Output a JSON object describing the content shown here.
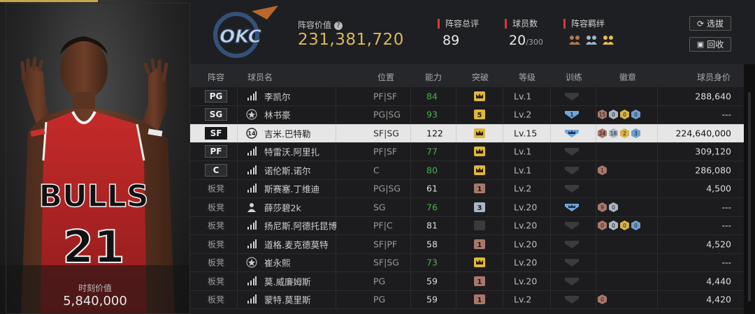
{
  "player_card": {
    "value_label": "时刻价值",
    "value": "5,840,000",
    "jersey_team": "BULLS",
    "jersey_number": "21"
  },
  "header": {
    "team_logo": "OKC",
    "lineup_value_label": "阵容价值",
    "lineup_value": "231,381,720",
    "rating_label": "阵容总评",
    "rating_value": "89",
    "count_label": "球员数",
    "count_value": "20",
    "count_max": "/300",
    "bond_label": "阵容羁绊",
    "select_button": "选拔",
    "recycle_button": "回收"
  },
  "table": {
    "headers": {
      "lineup": "阵容",
      "name": "球员名",
      "position": "位置",
      "ability": "能力",
      "breakthrough": "突破",
      "level": "等级",
      "training": "训练",
      "badges": "徽章",
      "price": "球员身价"
    },
    "rows": [
      {
        "slot": "PG",
        "bench": false,
        "role": "chart",
        "name": "李凯尔",
        "pos": "PF|SF",
        "ability": "84",
        "ability_color": "#4caf50",
        "break": "crown",
        "break_tier": "gold",
        "level": "Lv.1",
        "train": "none",
        "badges": [],
        "price": "288,640"
      },
      {
        "slot": "SG",
        "bench": false,
        "role": "star",
        "name": "林书豪",
        "pos": "PG|SG",
        "ability": "93",
        "ability_color": "#4caf50",
        "break": "5",
        "break_tier": "gold",
        "level": "Lv.2",
        "train": "1",
        "badges": [
          "15",
          "0",
          "0",
          "0"
        ],
        "price": "---"
      },
      {
        "slot": "SF",
        "bench": false,
        "role": "jersey-14",
        "name": "吉米.巴特勒",
        "pos": "SF|SG",
        "ability": "122",
        "ability_color": "#111111",
        "break": "crown",
        "break_tier": "gold",
        "level": "Lv.15",
        "train": "crown",
        "badges": [
          "24",
          "18",
          "2",
          "3"
        ],
        "price": "224,640,000",
        "selected": true
      },
      {
        "slot": "PF",
        "bench": false,
        "role": "chart",
        "name": "特雷沃.阿里扎",
        "pos": "PF|SF",
        "ability": "77",
        "ability_color": "#4caf50",
        "break": "crown",
        "break_tier": "gold",
        "level": "Lv.1",
        "train": "none",
        "badges": [],
        "price": "309,120"
      },
      {
        "slot": "C",
        "bench": false,
        "role": "chart",
        "name": "诺伦斯.诺尔",
        "pos": "C",
        "ability": "80",
        "ability_color": "#4caf50",
        "break": "crown",
        "break_tier": "gold",
        "level": "Lv.1",
        "train": "none",
        "badges": [
          "1"
        ],
        "price": "286,080"
      },
      {
        "slot": "板凳",
        "bench": true,
        "role": "chart",
        "name": "斯赛塞.丁维迪",
        "pos": "PG|SG",
        "ability": "61",
        "ability_color": "#dddddd",
        "break": "1",
        "break_tier": "bronze",
        "level": "Lv.2",
        "train": "none",
        "badges": [],
        "price": "4,500"
      },
      {
        "slot": "板凳",
        "bench": true,
        "role": "person",
        "name": "薛莎碧2k",
        "pos": "SG",
        "ability": "76",
        "ability_color": "#4caf50",
        "break": "3",
        "break_tier": "silver",
        "level": "Lv.20",
        "train": "crown",
        "badges": [
          "9",
          "0"
        ],
        "price": "---"
      },
      {
        "slot": "板凳",
        "bench": true,
        "role": "chart",
        "name": "扬尼斯.阿德托昆博",
        "pos": "PF|C",
        "ability": "81",
        "ability_color": "#dddddd",
        "break": "",
        "break_tier": "none",
        "level": "Lv.20",
        "train": "none",
        "badges": [
          "0",
          "0",
          "0",
          "0"
        ],
        "price": "---"
      },
      {
        "slot": "板凳",
        "bench": true,
        "role": "chart",
        "name": "道格.麦克德莫特",
        "pos": "SF|PF",
        "ability": "58",
        "ability_color": "#dddddd",
        "break": "1",
        "break_tier": "bronze",
        "level": "Lv.20",
        "train": "none",
        "badges": [],
        "price": "4,520"
      },
      {
        "slot": "板凳",
        "bench": true,
        "role": "star",
        "name": "崔永熙",
        "pos": "SF|SG",
        "ability": "73",
        "ability_color": "#4caf50",
        "break": "crown",
        "break_tier": "gold",
        "level": "Lv.20",
        "train": "none",
        "badges": [],
        "price": "---"
      },
      {
        "slot": "板凳",
        "bench": true,
        "role": "chart",
        "name": "莫.威廉姆斯",
        "pos": "PG",
        "ability": "59",
        "ability_color": "#dddddd",
        "break": "1",
        "break_tier": "bronze",
        "level": "Lv.20",
        "train": "none",
        "badges": [],
        "price": "4,440"
      },
      {
        "slot": "板凳",
        "bench": true,
        "role": "chart",
        "name": "蒙特.莫里斯",
        "pos": "PG",
        "ability": "59",
        "ability_color": "#dddddd",
        "break": "1",
        "break_tier": "bronze",
        "level": "Lv.2",
        "train": "none",
        "badges": [
          "0"
        ],
        "price": "4,420"
      }
    ]
  },
  "colors": {
    "accent_gold": "#d9b85a",
    "tag_red": "#d43a3a",
    "ability_green": "#4caf50",
    "selected_row_bg": "#e6e6e6"
  }
}
